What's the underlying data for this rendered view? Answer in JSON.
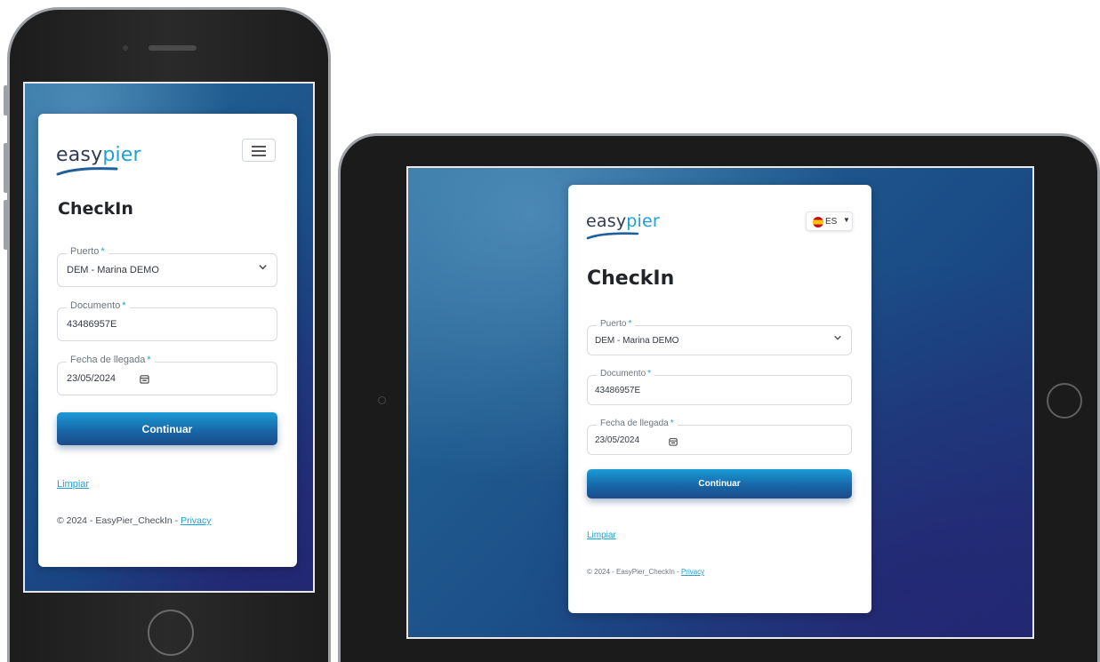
{
  "app": {
    "logo_part1": "easy",
    "logo_part2": "pier",
    "page_title": "CheckIn",
    "language_code": "ES",
    "brand_color": "#1ea0d6"
  },
  "form": {
    "puerto": {
      "label": "Puerto",
      "required_mark": "*",
      "value": "DEM - Marina DEMO"
    },
    "documento": {
      "label": "Documento",
      "required_mark": "*",
      "value": "43486957E"
    },
    "fecha": {
      "label": "Fecha de llegada",
      "required_mark": "*",
      "value": "23/05/2024"
    },
    "submit_label": "Continuar",
    "clear_label": "Limpiar"
  },
  "footer": {
    "text": "© 2024 - EasyPier_CheckIn - ",
    "privacy_label": "Privacy"
  },
  "icons": {
    "menu": "hamburger-icon",
    "dropdown": "chevron-down-icon",
    "calendar": "calendar-icon",
    "flag": "spain-flag-icon"
  }
}
